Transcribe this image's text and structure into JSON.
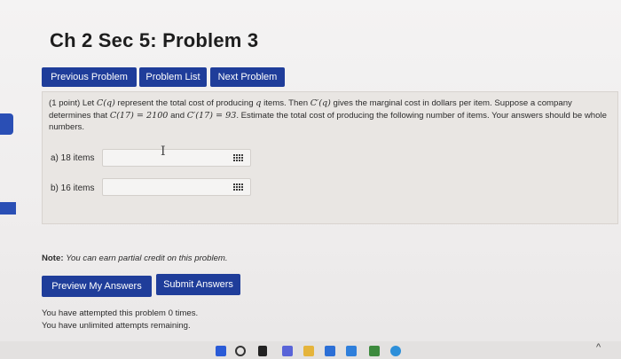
{
  "header": {
    "title": "Ch 2 Sec 5: Problem 3"
  },
  "nav": {
    "previous": "Previous Problem",
    "list": "Problem List",
    "next": "Next Problem"
  },
  "problem": {
    "points": "(1 point) Let",
    "t1": "represent the total cost of producing",
    "t2": "items. Then",
    "t3": "gives the marginal cost in dollars per item. Suppose a",
    "t4": "company determines that",
    "t5": "and",
    "t6": ". Estimate the total cost of producing the following number of items. Your",
    "t7": "answers should be whole numbers.",
    "m_Cq": "C(q)",
    "m_q": "q",
    "m_Cpq": "C′(q)",
    "m_C17": "C(17) = 2100",
    "m_Cp17": "C′(17) = 93",
    "parts": [
      {
        "label": "a) 18 items",
        "value": ""
      },
      {
        "label": "b) 16 items",
        "value": ""
      }
    ]
  },
  "note": {
    "label": "Note:",
    "text": "You can earn partial credit on this problem."
  },
  "actions": {
    "preview": "Preview My Answers",
    "submit": "Submit Answers"
  },
  "attempts": {
    "line1": "You have attempted this problem 0 times.",
    "line2": "You have unlimited attempts remaining."
  },
  "colors": {
    "button": "#1f3d9a",
    "background": "#f2f1f1"
  }
}
